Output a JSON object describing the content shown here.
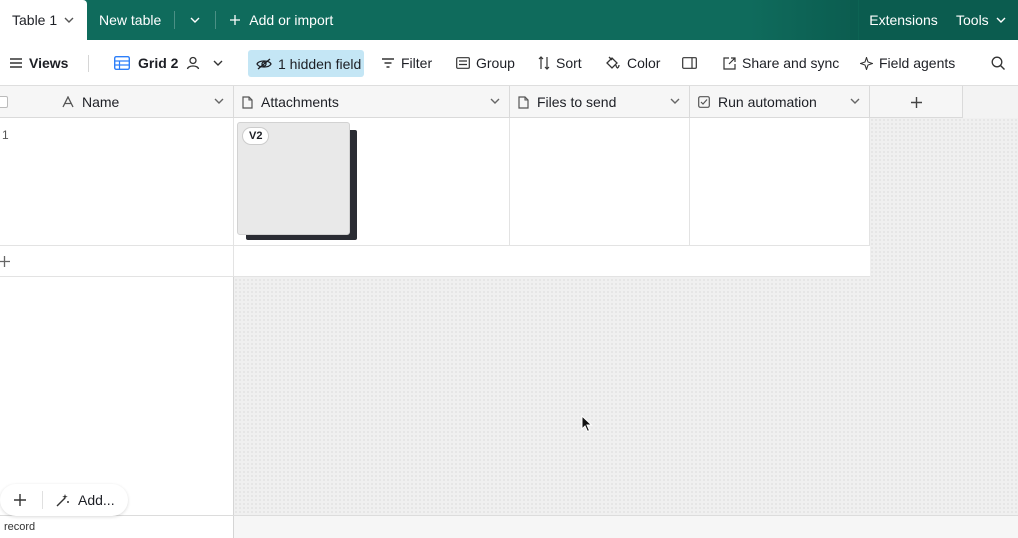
{
  "tabs": {
    "active_label": "Table 1",
    "new_table_label": "New table",
    "add_import_label": "Add or import",
    "extensions_label": "Extensions",
    "tools_label": "Tools"
  },
  "toolbar": {
    "views_label": "Views",
    "view_name": "Grid 2",
    "hidden_fields_label": "1 hidden field",
    "filter_label": "Filter",
    "group_label": "Group",
    "sort_label": "Sort",
    "color_label": "Color",
    "share_label": "Share and sync",
    "field_agents_label": "Field agents"
  },
  "grid": {
    "columns": [
      {
        "name": "Name",
        "icon": "text-icon"
      },
      {
        "name": "Attachments",
        "icon": "file-icon"
      },
      {
        "name": "Files to send",
        "icon": "file-icon"
      },
      {
        "name": "Run automation",
        "icon": "checkbox-icon"
      }
    ],
    "rows": [
      {
        "number": "1",
        "attachment_badge": "V2"
      }
    ]
  },
  "bottom": {
    "add_label": "Add...",
    "record_count_label": "record"
  },
  "colors": {
    "tab_bar": "#0f6b5c",
    "hidden_field_highlight": "#c4e6f5"
  }
}
